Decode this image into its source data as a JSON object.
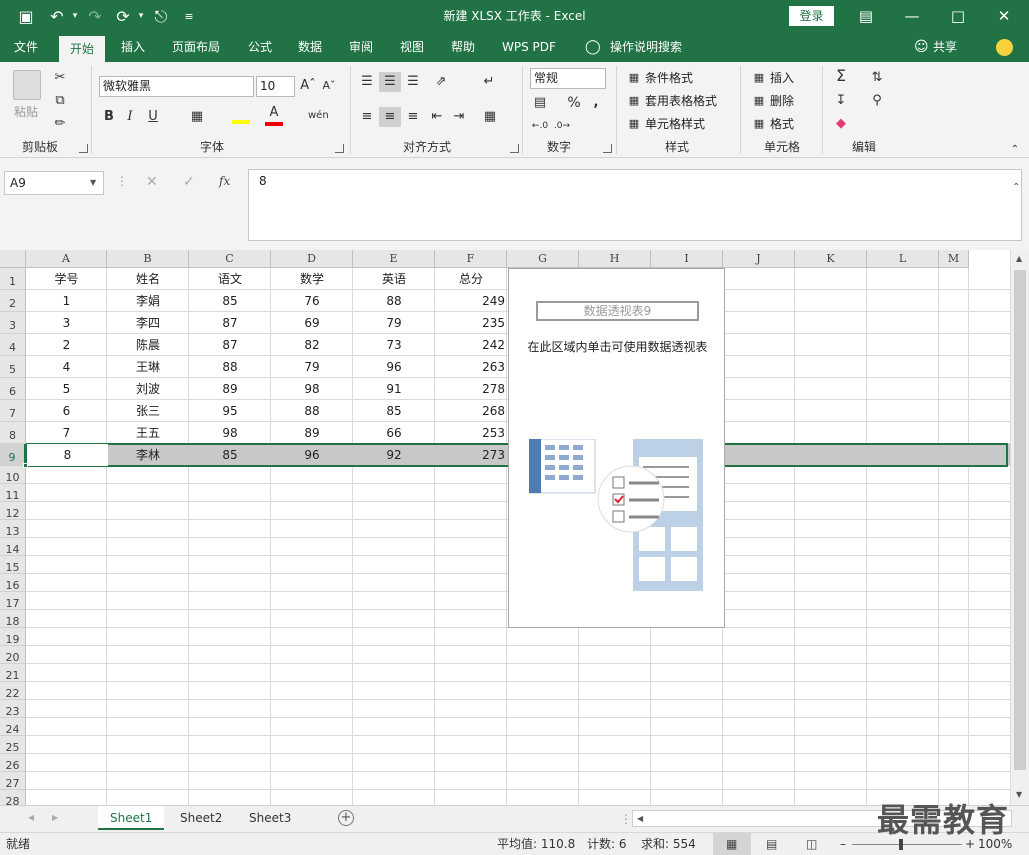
{
  "window": {
    "title": "新建 XLSX 工作表  -  Excel",
    "login": "登录",
    "share": "共享"
  },
  "menu": [
    "文件",
    "开始",
    "插入",
    "页面布局",
    "公式",
    "数据",
    "审阅",
    "视图",
    "帮助",
    "WPS PDF",
    "操作说明搜索"
  ],
  "ribbon": {
    "clipboard": {
      "paste": "粘贴",
      "label": "剪贴板"
    },
    "font": {
      "name": "微软雅黑",
      "size": "10",
      "bold": "B",
      "italic": "I",
      "underline": "U",
      "font_color": "A",
      "wen": "wén",
      "label": "字体"
    },
    "align": {
      "label": "对齐方式"
    },
    "number": {
      "format": "常规",
      "percent": "%",
      "comma": ",",
      "label": "数字"
    },
    "styles": {
      "cond": "条件格式",
      "table": "套用表格格式",
      "cell": "单元格样式",
      "label": "样式"
    },
    "cells": {
      "insert": "插入",
      "delete": "删除",
      "format": "格式",
      "label": "单元格"
    },
    "editing": {
      "sigma": "Σ",
      "label": "编辑"
    }
  },
  "formula_bar": {
    "name_box": "A9",
    "fx": "fx",
    "content": "8"
  },
  "columns": [
    "A",
    "B",
    "C",
    "D",
    "E",
    "F",
    "G",
    "H",
    "I",
    "J",
    "K",
    "L",
    "M"
  ],
  "rows": [
    "1",
    "2",
    "3",
    "4",
    "5",
    "6",
    "7",
    "8",
    "9",
    "10",
    "11",
    "12",
    "13",
    "14",
    "15",
    "16",
    "17",
    "18",
    "19",
    "20",
    "21",
    "22",
    "23",
    "24",
    "25",
    "26",
    "27",
    "28"
  ],
  "table": {
    "headers": [
      "学号",
      "姓名",
      "语文",
      "数学",
      "英语",
      "总分"
    ],
    "data": [
      [
        "1",
        "李娟",
        "85",
        "76",
        "88",
        "249"
      ],
      [
        "3",
        "李四",
        "87",
        "69",
        "79",
        "235"
      ],
      [
        "2",
        "陈晨",
        "87",
        "82",
        "73",
        "242"
      ],
      [
        "4",
        "王琳",
        "88",
        "79",
        "96",
        "263"
      ],
      [
        "5",
        "刘波",
        "89",
        "98",
        "91",
        "278"
      ],
      [
        "6",
        "张三",
        "95",
        "88",
        "85",
        "268"
      ],
      [
        "7",
        "王五",
        "98",
        "89",
        "66",
        "253"
      ],
      [
        "8",
        "李林",
        "85",
        "96",
        "92",
        "273"
      ]
    ]
  },
  "pivot": {
    "name": "数据透视表9",
    "hint": "在此区域内单击可使用数据透视表"
  },
  "sheets": [
    "Sheet1",
    "Sheet2",
    "Sheet3"
  ],
  "status": {
    "ready": "就绪",
    "average": "平均值: 110.8",
    "count": "计数: 6",
    "sum": "求和: 554",
    "zoom": "100%"
  },
  "watermark": "最需教育",
  "colors": {
    "accent": "#217346"
  }
}
